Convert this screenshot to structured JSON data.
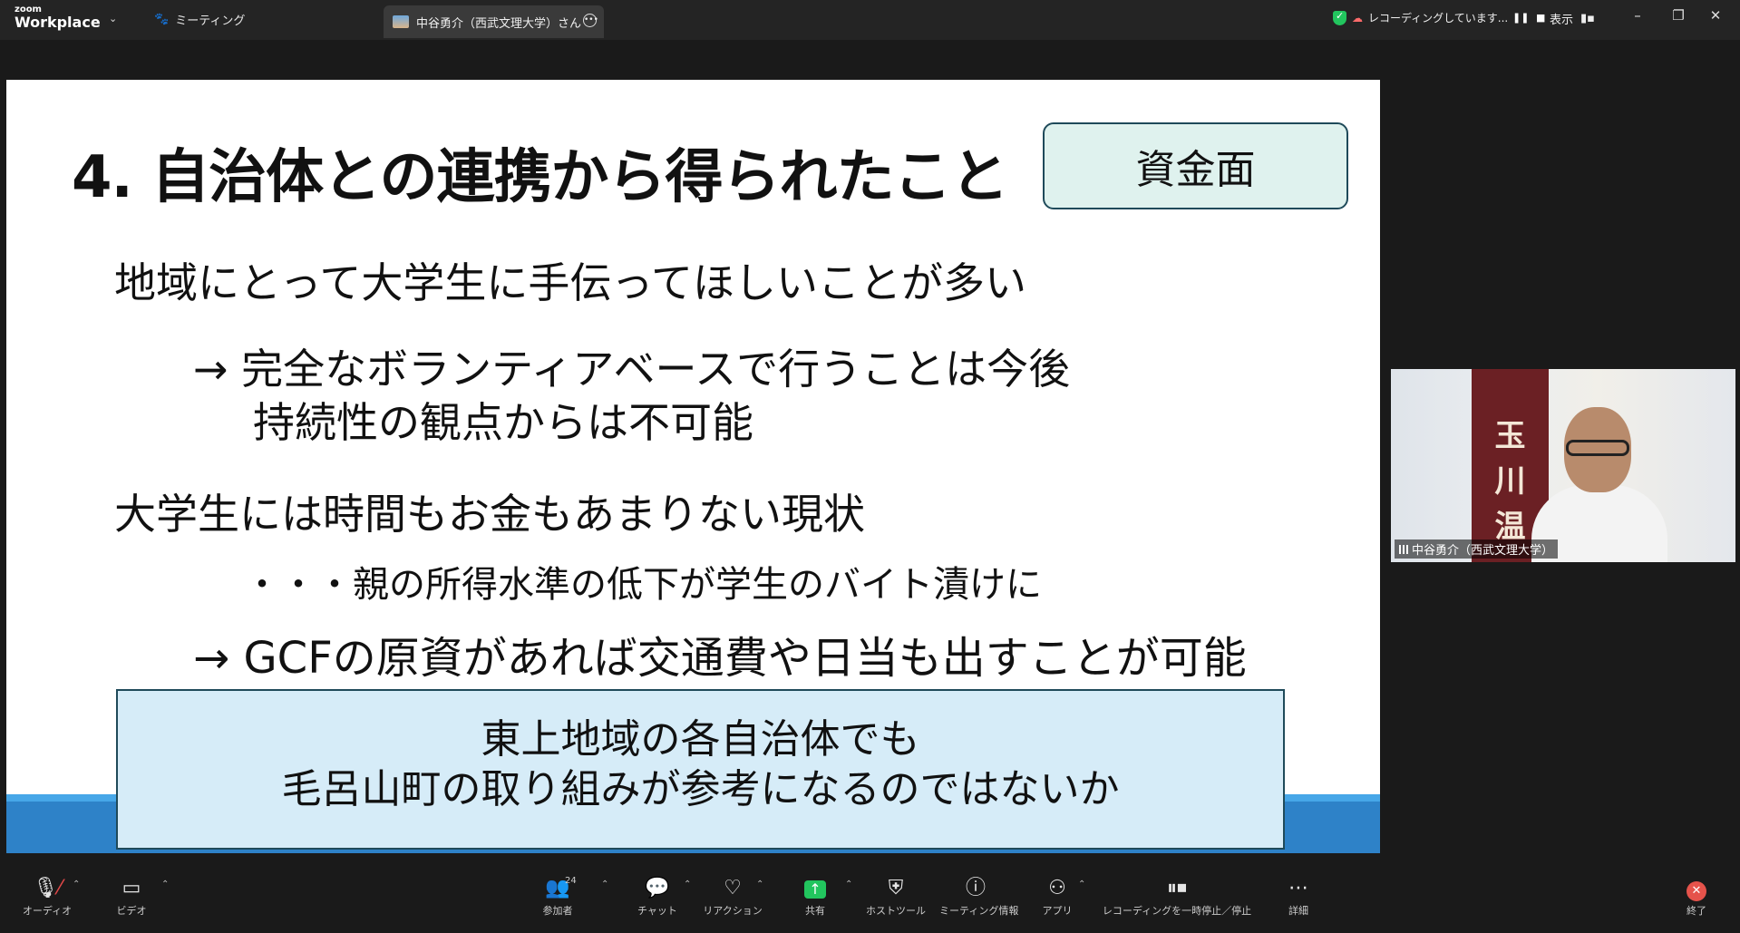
{
  "topbar": {
    "logo_small": "zoom",
    "logo_big": "Workplace",
    "meeting_tab": "ミーティング",
    "active_tab": "中谷勇介（西武文理大学）さん",
    "recording_status": "レコーディングしています...",
    "view_label": "表示"
  },
  "slide": {
    "title": "4. 自治体との連携から得られたこと",
    "tag": "資金面",
    "line1": "地域にとって大学生に手伝ってほしいことが多い",
    "line2": "→ 完全なボランティアベースで行うことは今後",
    "line3": "持続性の観点からは不可能",
    "line4": "大学生には時間もお金もあまりない現状",
    "line5": "・・・親の所得水準の低下が学生のバイト漬けに",
    "line6": "→ GCFの原資があれば交通費や日当も出すことが可能",
    "callout_line1": "東上地域の各自治体でも",
    "callout_line2": "毛呂山町の取り組みが参考になるのではないか"
  },
  "video": {
    "participant_name": "中谷勇介（西武文理大学）",
    "board_chars": [
      "玉",
      "川",
      "温"
    ]
  },
  "toolbar": {
    "audio": "オーディオ",
    "video": "ビデオ",
    "participants": "参加者",
    "participants_count": "24",
    "chat": "チャット",
    "reactions": "リアクション",
    "share": "共有",
    "host_tools": "ホストツール",
    "meeting_info": "ミーティング情報",
    "apps": "アプリ",
    "recording_control": "レコーディングを一時停止／停止",
    "more": "詳細",
    "end": "終了"
  },
  "colors": {
    "share_green": "#22c55e",
    "end_red": "#e5534b",
    "slide_footer_blue": "#2e82c8",
    "callout_bg": "#d6ecf8",
    "tag_bg": "#dff2ee"
  }
}
